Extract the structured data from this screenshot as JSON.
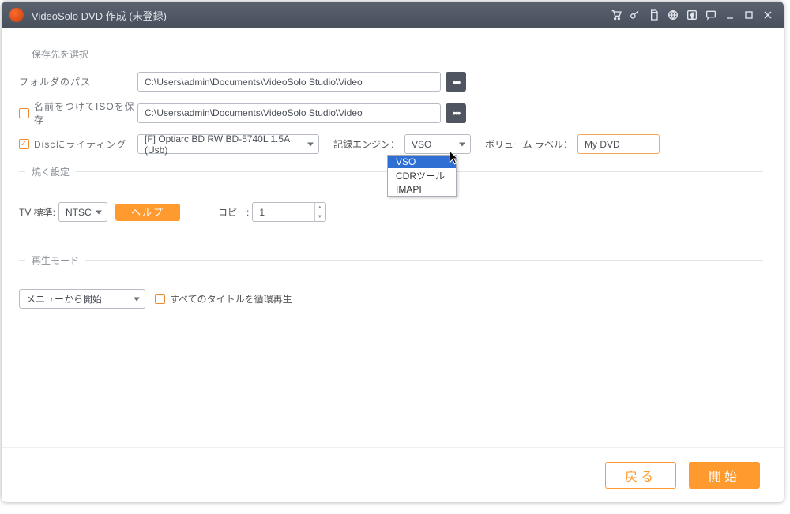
{
  "title": "VideoSolo DVD 作成 (未登録)",
  "sections": {
    "save": "保存先を選択",
    "burn": "焼く設定",
    "play": "再生モード"
  },
  "labels": {
    "folder_path": "フォルダのパス",
    "save_iso": "名前をつけてISOを保存",
    "write_disc": "Discにライティング",
    "engine": "記録エンジン：",
    "volume": "ボリューム ラベル：",
    "tv_standard": "TV 標準:",
    "copies": "コピー:",
    "loop_titles": "すべてのタイトルを循環再生"
  },
  "values": {
    "folder_path": "C:\\Users\\admin\\Documents\\VideoSolo Studio\\Video",
    "iso_path": "C:\\Users\\admin\\Documents\\VideoSolo Studio\\Video",
    "drive": "[F] Optiarc BD RW BD-5740L 1.5A (Usb)",
    "engine": "VSO",
    "volume": "My DVD",
    "tv_standard": "NTSC",
    "copies": "1",
    "play_start": "メニューから開始"
  },
  "engine_options": [
    "VSO",
    "CDRツール",
    "IMAPI"
  ],
  "buttons": {
    "help": "ヘルプ",
    "back": "戻る",
    "start": "開始"
  }
}
